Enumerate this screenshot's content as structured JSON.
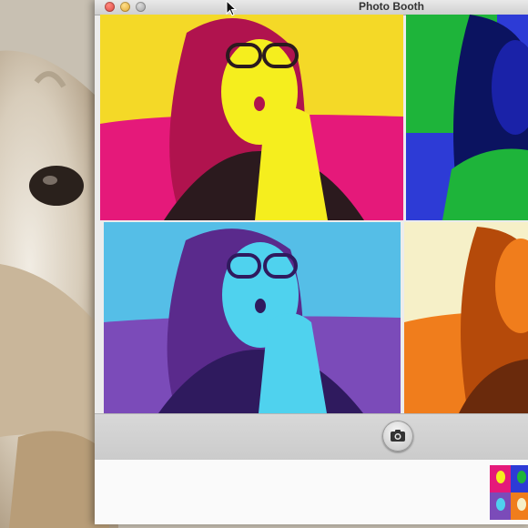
{
  "window": {
    "title": "Photo Booth"
  },
  "colors": {
    "tile1": {
      "background": "#e5197a",
      "face": "#f5ee1e",
      "hair": "#b0134e",
      "shirt": "#2b1a1e"
    },
    "tile2": {
      "background": "#2d3bd6",
      "face": "#1a22a8",
      "hair": "#0b1360",
      "shirt": "#1eb43a"
    },
    "tile3": {
      "background": "#7b4bb9",
      "face": "#4fd2ee",
      "hair": "#5a2a8c",
      "shirt": "#2f1a5e"
    },
    "tile4": {
      "background": "#f07d1c",
      "face": "#f6f0c8",
      "hair": "#b54a0a",
      "shirt": "#6a2a0c"
    }
  },
  "icons": {
    "shutter": "camera-icon",
    "traffic": [
      "close-icon",
      "minimize-icon",
      "zoom-icon"
    ]
  }
}
